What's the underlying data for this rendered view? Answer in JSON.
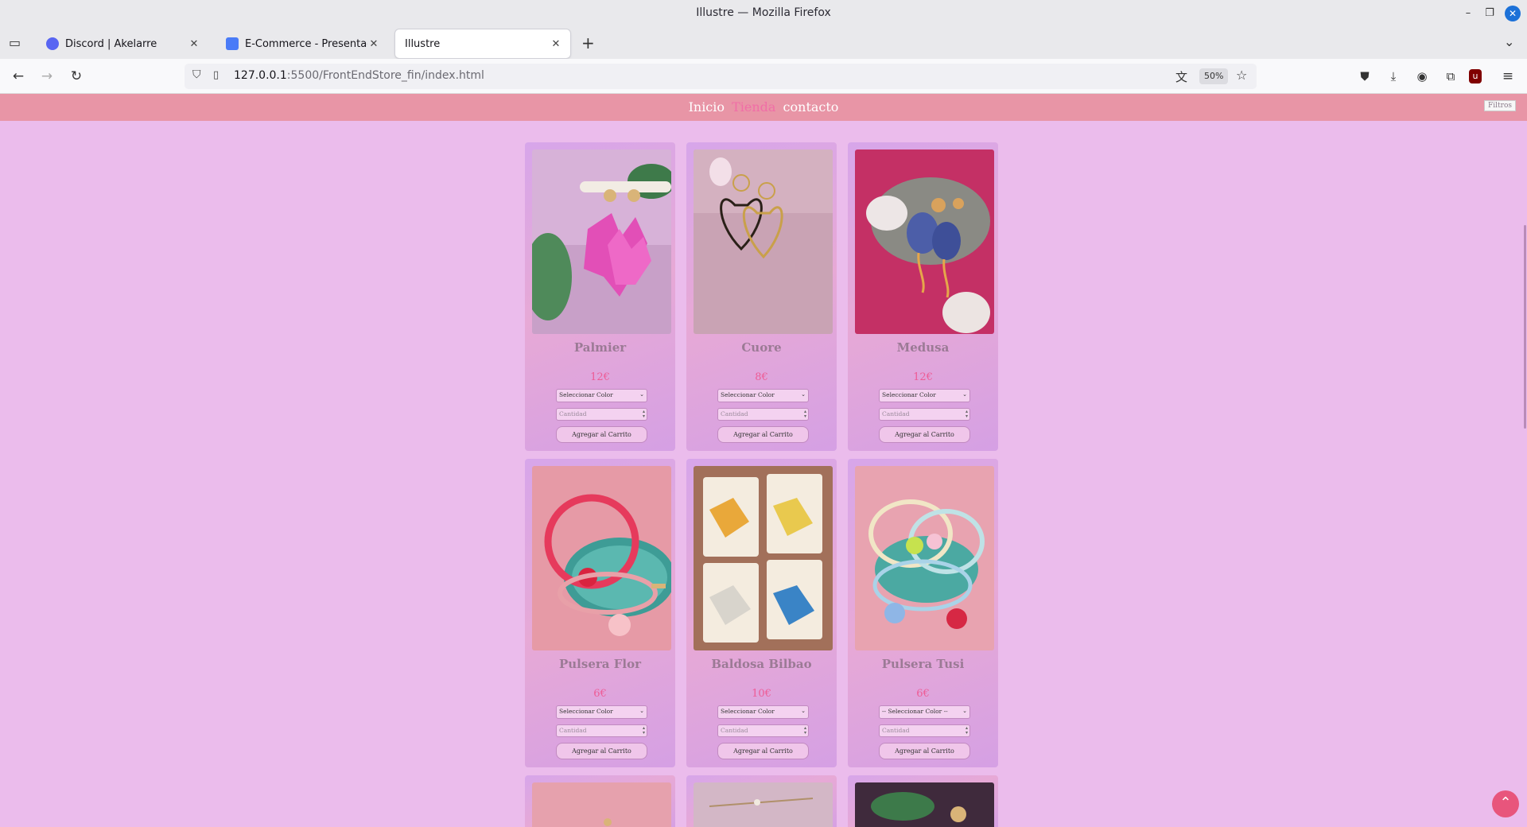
{
  "window": {
    "title": "Illustre — Mozilla Firefox"
  },
  "tabs": [
    {
      "label": "Discord | Akelarre",
      "icon": "discord-icon",
      "color": "#5865f2",
      "active": false
    },
    {
      "label": "E-Commerce - Presentación",
      "icon": "ecommerce-icon",
      "color": "#4a7bf7",
      "active": false
    },
    {
      "label": "Illustre",
      "icon": "",
      "color": "",
      "active": true
    }
  ],
  "address_bar": {
    "url_host": "127.0.0.1",
    "url_rest": ":5500/FrontEndStore_fin/index.html",
    "zoom": "50%"
  },
  "site": {
    "nav": {
      "inicio": "Inicio",
      "tienda": "Tienda",
      "contacto": "contacto"
    },
    "filtros": "Filtros",
    "accent_color": "#f16da7",
    "header_color": "#e895a6",
    "background_color": "#ebbcec"
  },
  "products": [
    {
      "name": "Palmier",
      "price": "12€",
      "select": "Seleccionar Color",
      "qty_placeholder": "Cantidad",
      "button": "Agregar al Carrito"
    },
    {
      "name": "Cuore",
      "price": "8€",
      "select": "Seleccionar Color",
      "qty_placeholder": "Cantidad",
      "button": "Agregar al Carrito"
    },
    {
      "name": "Medusa",
      "price": "12€",
      "select": "Seleccionar Color",
      "qty_placeholder": "Cantidad",
      "button": "Agregar al Carrito"
    },
    {
      "name": "Pulsera Flor",
      "price": "6€",
      "select": "Seleccionar Color",
      "qty_placeholder": "Cantidad",
      "button": "Agregar al Carrito"
    },
    {
      "name": "Baldosa Bilbao",
      "price": "10€",
      "select": "Seleccionar Color",
      "qty_placeholder": "Cantidad",
      "button": "Agregar al Carrito"
    },
    {
      "name": "Pulsera Tusi",
      "price": "6€",
      "select": "-- Seleccionar Color --",
      "qty_placeholder": "Cantidad",
      "button": "Agregar al Carrito"
    }
  ]
}
